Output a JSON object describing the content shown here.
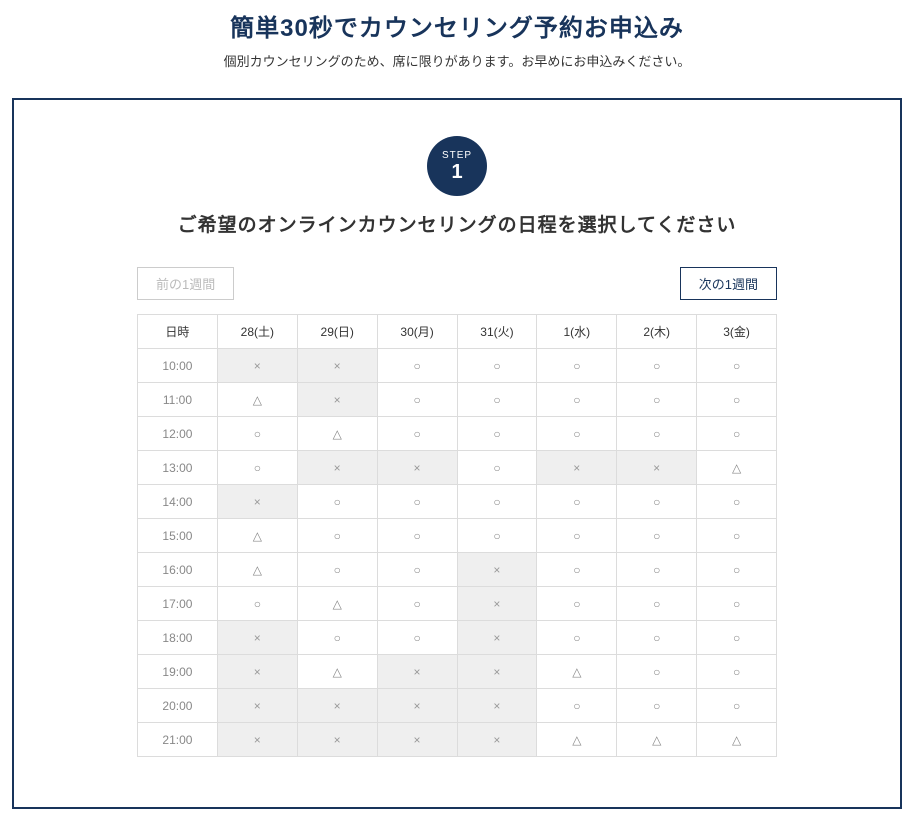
{
  "header": {
    "title": "簡単30秒でカウンセリング予約お申込み",
    "subtitle": "個別カウンセリングのため、席に限りがあります。お早めにお申込みください。"
  },
  "step": {
    "label": "STEP",
    "number": "1",
    "title": "ご希望のオンラインカウンセリングの日程を選択してください"
  },
  "nav": {
    "prev": "前の1週間",
    "next": "次の1週間"
  },
  "symbols": {
    "open": "○",
    "limited": "△",
    "closed": "×"
  },
  "table": {
    "time_header": "日時",
    "days": [
      "28(土)",
      "29(日)",
      "30(月)",
      "31(火)",
      "1(水)",
      "2(木)",
      "3(金)"
    ],
    "times": [
      "10:00",
      "11:00",
      "12:00",
      "13:00",
      "14:00",
      "15:00",
      "16:00",
      "17:00",
      "18:00",
      "19:00",
      "20:00",
      "21:00"
    ],
    "rows": [
      [
        "x",
        "x",
        "o",
        "o",
        "o",
        "o",
        "o"
      ],
      [
        "t",
        "x",
        "o",
        "o",
        "o",
        "o",
        "o"
      ],
      [
        "o",
        "t",
        "o",
        "o",
        "o",
        "o",
        "o"
      ],
      [
        "o",
        "x",
        "x",
        "o",
        "x",
        "x",
        "t"
      ],
      [
        "x",
        "o",
        "o",
        "o",
        "o",
        "o",
        "o"
      ],
      [
        "t",
        "o",
        "o",
        "o",
        "o",
        "o",
        "o"
      ],
      [
        "t",
        "o",
        "o",
        "x",
        "o",
        "o",
        "o"
      ],
      [
        "o",
        "t",
        "o",
        "x",
        "o",
        "o",
        "o"
      ],
      [
        "x",
        "o",
        "o",
        "x",
        "o",
        "o",
        "o"
      ],
      [
        "x",
        "t",
        "x",
        "x",
        "t",
        "o",
        "o"
      ],
      [
        "x",
        "x",
        "x",
        "x",
        "o",
        "o",
        "o"
      ],
      [
        "x",
        "x",
        "x",
        "x",
        "t",
        "t",
        "t"
      ]
    ]
  }
}
